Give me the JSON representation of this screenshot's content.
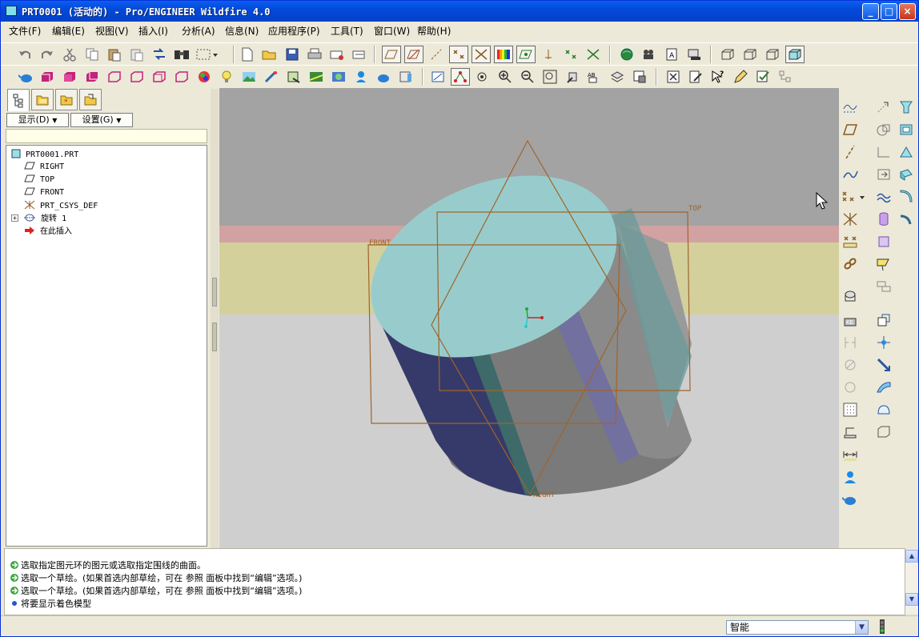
{
  "window": {
    "title": "PRT0001 (活动的) - Pro/ENGINEER Wildfire 4.0",
    "minimize": "_",
    "maximize": "□",
    "close": "×"
  },
  "menu": [
    "文件(F)",
    "编辑(E)",
    "视图(V)",
    "插入(I)",
    "分析(A)",
    "信息(N)",
    "应用程序(P)",
    "工具(T)",
    "窗口(W)",
    "帮助(H)"
  ],
  "left_panel": {
    "show_label": "显示(D)",
    "settings_label": "设置(G)",
    "dropdown_arrow": "▼",
    "tree": [
      {
        "label": "PRT0001.PRT",
        "icon": "part-icon"
      },
      {
        "label": "RIGHT",
        "icon": "datum-plane-icon"
      },
      {
        "label": "TOP",
        "icon": "datum-plane-icon"
      },
      {
        "label": "FRONT",
        "icon": "datum-plane-icon"
      },
      {
        "label": "PRT_CSYS_DEF",
        "icon": "csys-icon"
      },
      {
        "label": "旋转 1",
        "icon": "revolve-icon"
      },
      {
        "label": "在此插入",
        "icon": "insert-here-arrow-icon"
      }
    ],
    "expand_sign": "+"
  },
  "viewport": {
    "datum_labels": {
      "front": "FRONT",
      "top": "TOP",
      "right": "RIGHT"
    },
    "colors": {
      "bg_top": "#a3a3a3",
      "band_pink": "#d2a2a2",
      "band_yellow": "#d3d09c",
      "bg_bottom": "#cfcfcf",
      "top_face": "#98cccc",
      "datum": "#a0642a"
    }
  },
  "messages": [
    {
      "text": "选取指定图元环的图元或选取指定围线的曲面。",
      "icon": "prompt-arrow-icon"
    },
    {
      "text": "选取一个草绘。(如果首选内部草绘，可在 参照 面板中找到“编辑”选项。)",
      "icon": "prompt-arrow-icon"
    },
    {
      "text": "选取一个草绘。(如果首选内部草绘，可在 参照 面板中找到“编辑”选项。)",
      "icon": "prompt-arrow-icon"
    },
    {
      "text": "将要显示着色模型",
      "icon": "info-dot-icon"
    }
  ],
  "status": {
    "filter_value": "智能",
    "filter_arrow": "▼",
    "scroll_up": "▲",
    "scroll_down": "▼"
  }
}
